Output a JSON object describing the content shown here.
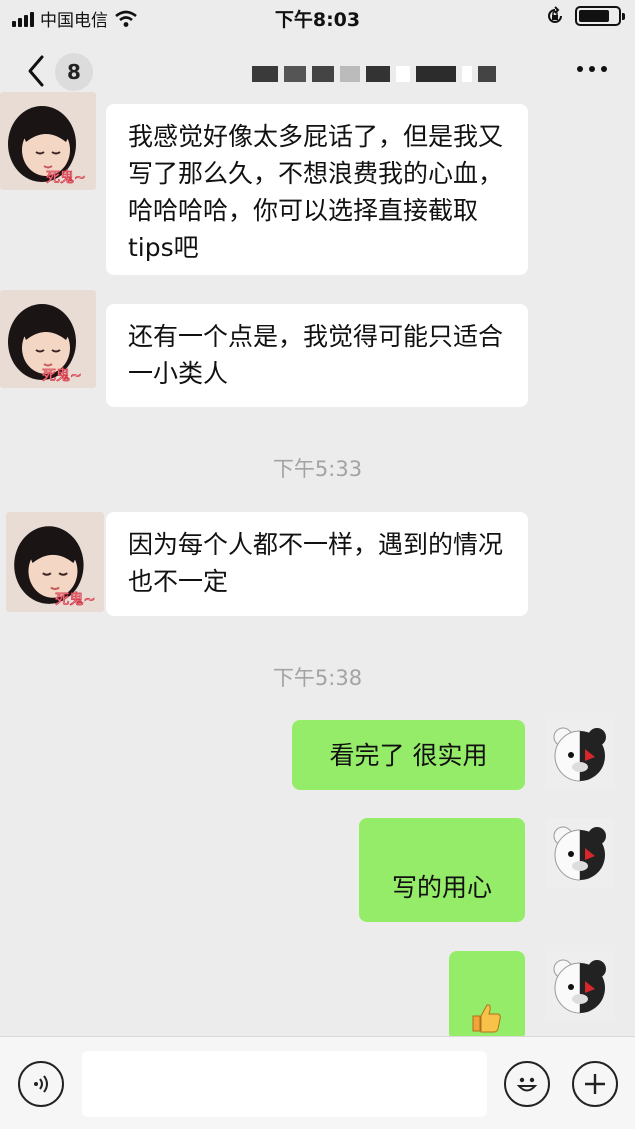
{
  "status_bar": {
    "carrier": "中国电信",
    "time": "下午8:03"
  },
  "nav": {
    "unread_count": "8"
  },
  "messages": [
    {
      "from": "contact",
      "text": "我感觉好像太多屁话了，但是我又写了那么久，不想浪费我的心血，哈哈哈哈，你可以选择直接截取tips吧"
    },
    {
      "from": "contact",
      "text": "还有一个点是，我觉得可能只适合一小类人"
    },
    {
      "timestamp": "下午5:33"
    },
    {
      "from": "contact",
      "text": "因为每个人都不一样，遇到的情况也不一定"
    },
    {
      "timestamp": "下午5:38"
    },
    {
      "from": "me",
      "text": "看完了 很实用"
    },
    {
      "from": "me",
      "text": "写的用心"
    },
    {
      "from": "me",
      "text": "",
      "icon": "thumbs-up-emoji"
    }
  ],
  "avatar": {
    "sticker_text": "死鬼~"
  },
  "colors": {
    "background": "#ececec",
    "incoming_bubble": "#ffffff",
    "outgoing_bubble": "#95ec69",
    "timestamp": "#a3a3a3"
  },
  "input_bar": {
    "voice_icon": "voice-icon",
    "emoji_icon": "smiley-icon",
    "more_icon": "plus-icon"
  }
}
